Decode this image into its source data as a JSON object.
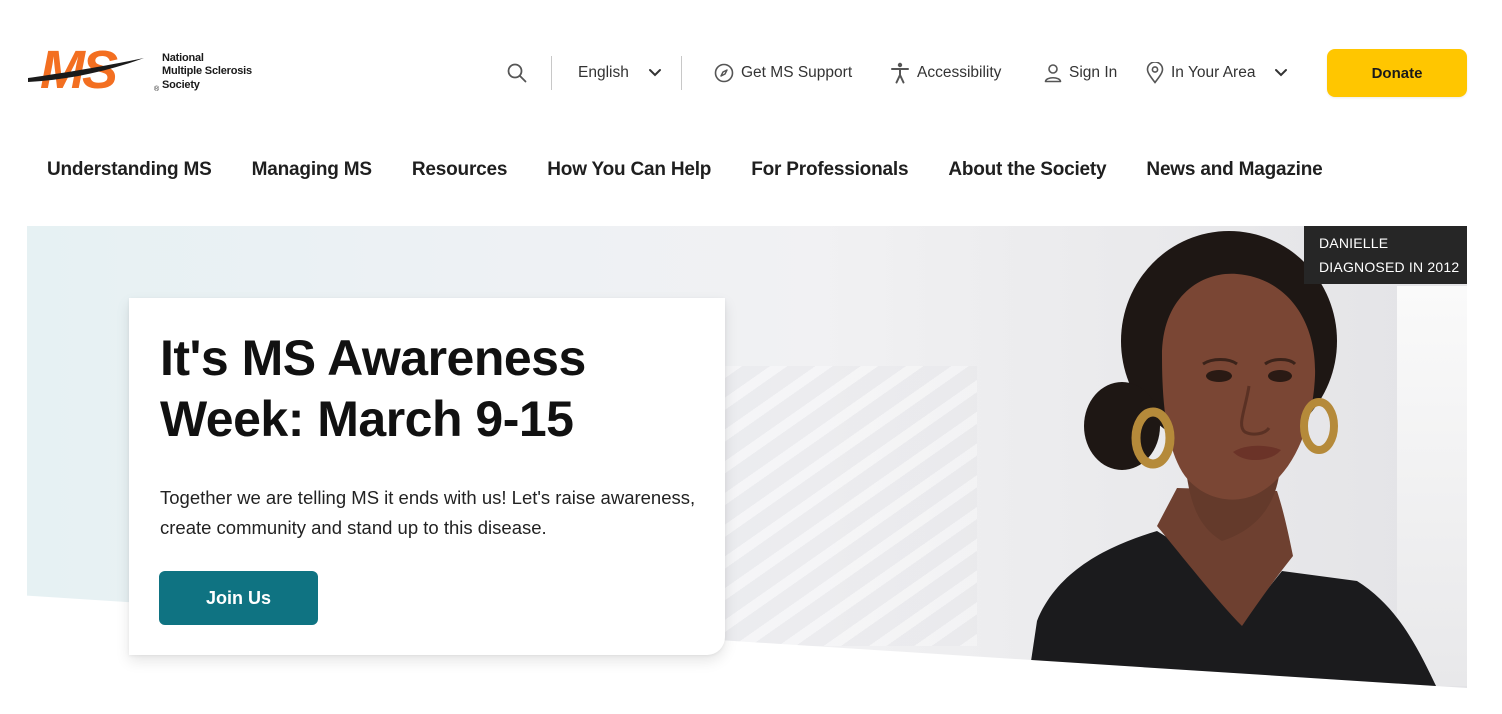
{
  "brand": {
    "logo_letters": "MS",
    "name_lines": [
      "National",
      "Multiple Sclerosis",
      "Society"
    ],
    "color": "#f36f21"
  },
  "utility": {
    "search_icon": "search-icon",
    "language": "English",
    "support": "Get MS Support",
    "accessibility": "Accessibility",
    "sign_in": "Sign In",
    "area": "In Your Area",
    "donate": "Donate",
    "donate_color": "#ffc600"
  },
  "nav": {
    "items": [
      "Understanding MS",
      "Managing MS",
      "Resources",
      "How You Can Help",
      "For Professionals",
      "About the Society",
      "News and Magazine"
    ]
  },
  "hero": {
    "title": "It's MS Awareness Week: March 9-15",
    "body": "Together we are telling MS it ends with us! Let's raise awareness, create community and stand up to this disease.",
    "cta": "Join Us",
    "cta_color": "#0f7382",
    "tag": {
      "name": "DANIELLE",
      "caption": "DIAGNOSED IN 2012"
    }
  }
}
